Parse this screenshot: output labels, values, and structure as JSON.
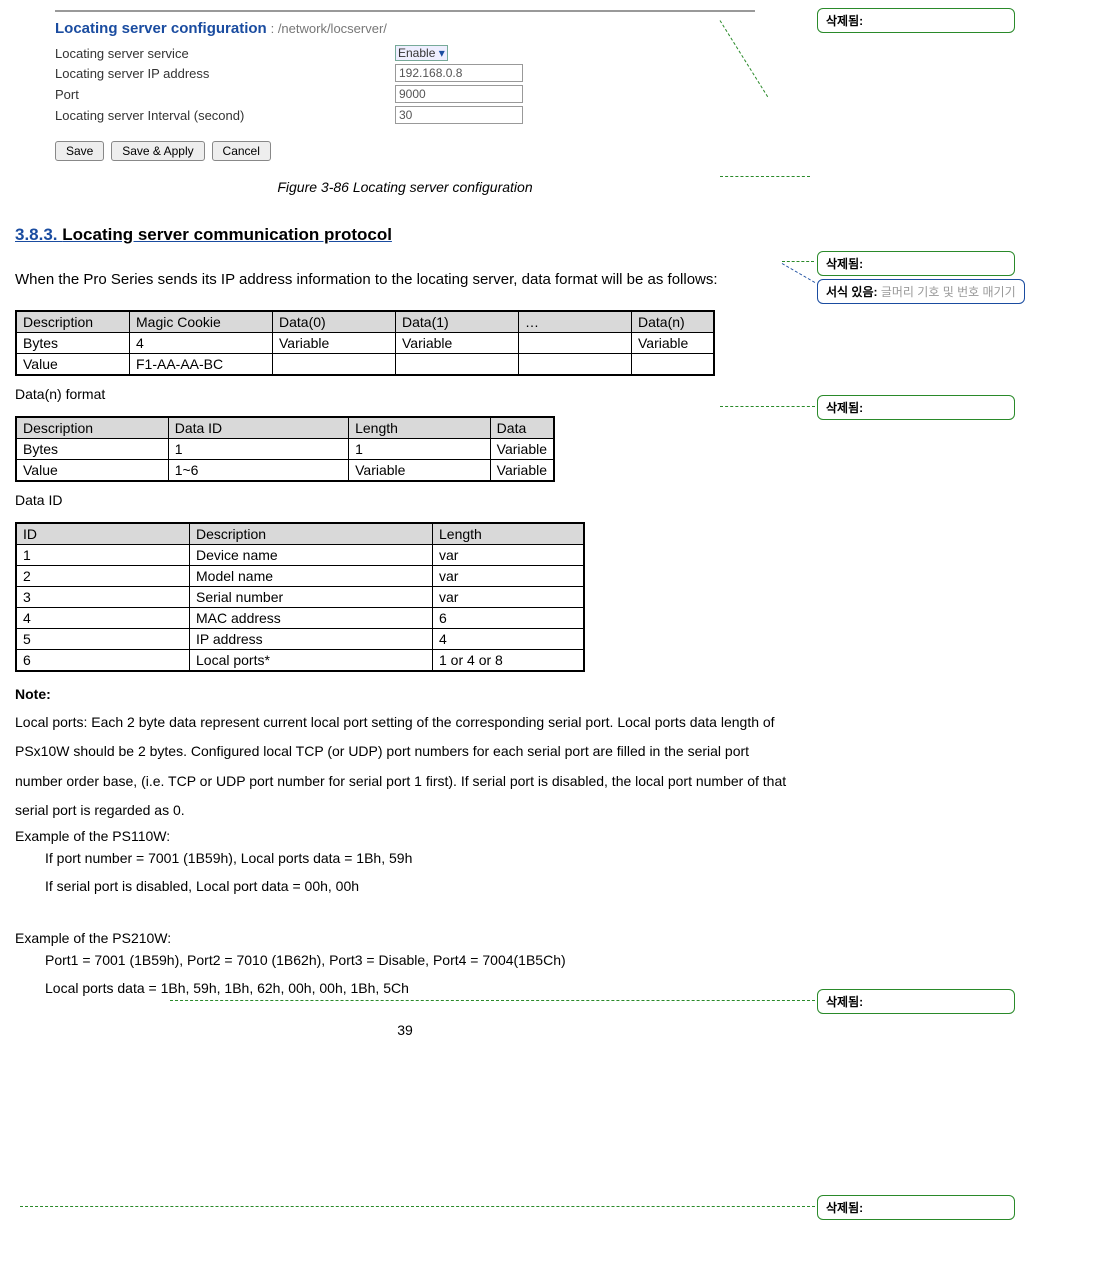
{
  "config_panel": {
    "title": "Locating server configuration",
    "path": ": /network/locserver/",
    "rows": [
      {
        "label": "Locating server service",
        "value": "Enable",
        "type": "select"
      },
      {
        "label": "Locating server IP address",
        "value": "192.168.0.8",
        "type": "input"
      },
      {
        "label": "Port",
        "value": "9000",
        "type": "input"
      },
      {
        "label": "Locating server Interval (second)",
        "value": "30",
        "type": "input"
      }
    ],
    "buttons": {
      "save": "Save",
      "save_apply": "Save & Apply",
      "cancel": "Cancel"
    }
  },
  "figure_caption": "Figure 3-86 Locating server configuration",
  "section_number": "3.8.3. ",
  "section_title": "Locating server communication protocol",
  "intro_text": "When the Pro Series sends its IP address information to the locating server, data format will be as follows:",
  "table1": {
    "headers": [
      "Description",
      "Magic Cookie",
      "Data(0)",
      "Data(1)",
      "…",
      "Data(n)"
    ],
    "rows": [
      [
        "Bytes",
        "4",
        "Variable",
        "Variable",
        "",
        "Variable"
      ],
      [
        "Value",
        "F1-AA-AA-BC",
        "",
        "",
        "",
        ""
      ]
    ]
  },
  "table2_label": "Data(n) format",
  "table2": {
    "headers": [
      "Description",
      "Data ID",
      "Length",
      "Data"
    ],
    "rows": [
      [
        "Bytes",
        "1",
        "1",
        "Variable"
      ],
      [
        "Value",
        "1~6",
        "Variable",
        "Variable"
      ]
    ]
  },
  "table3_label": "Data ID",
  "table3": {
    "headers": [
      "ID",
      "Description",
      "Length"
    ],
    "rows": [
      [
        "1",
        "Device name",
        "var"
      ],
      [
        "2",
        "Model name",
        "var"
      ],
      [
        "3",
        "Serial number",
        "var"
      ],
      [
        "4",
        "MAC address",
        "6"
      ],
      [
        "5",
        "IP address",
        "4"
      ],
      [
        "6",
        "Local ports*",
        "1 or 4 or 8"
      ]
    ]
  },
  "note_label": "Note:",
  "note_text": "Local ports: Each 2 byte data represent current local port setting of the corresponding serial port. Local ports data length of PSx10W should be 2 bytes.   Configured local TCP (or UDP) port numbers for each serial port are filled in the serial port number order base, (i.e. TCP or UDP port number for serial port 1 first). If serial port is disabled, the local port number of that serial port is regarded as 0.",
  "example1_label": "Example of the PS110W:",
  "example1_lines": [
    "If port number = 7001 (1B59h), Local ports data = 1Bh, 59h",
    "If serial port is disabled, Local port data = 00h, 00h"
  ],
  "example2_label": "Example of the PS210W:",
  "example2_lines": [
    "Port1 = 7001 (1B59h), Port2 = 7010 (1B62h), Port3 = Disable, Port4 = 7004(1B5Ch)",
    "Local ports data = 1Bh, 59h, 1Bh, 62h, 00h, 00h, 1Bh, 5Ch"
  ],
  "page_number": "39",
  "balloons": {
    "deleted_label": "삭제됨:",
    "format_label": "서식 있음:",
    "format_text": " 글머리 기호 및 번호 매기기"
  }
}
